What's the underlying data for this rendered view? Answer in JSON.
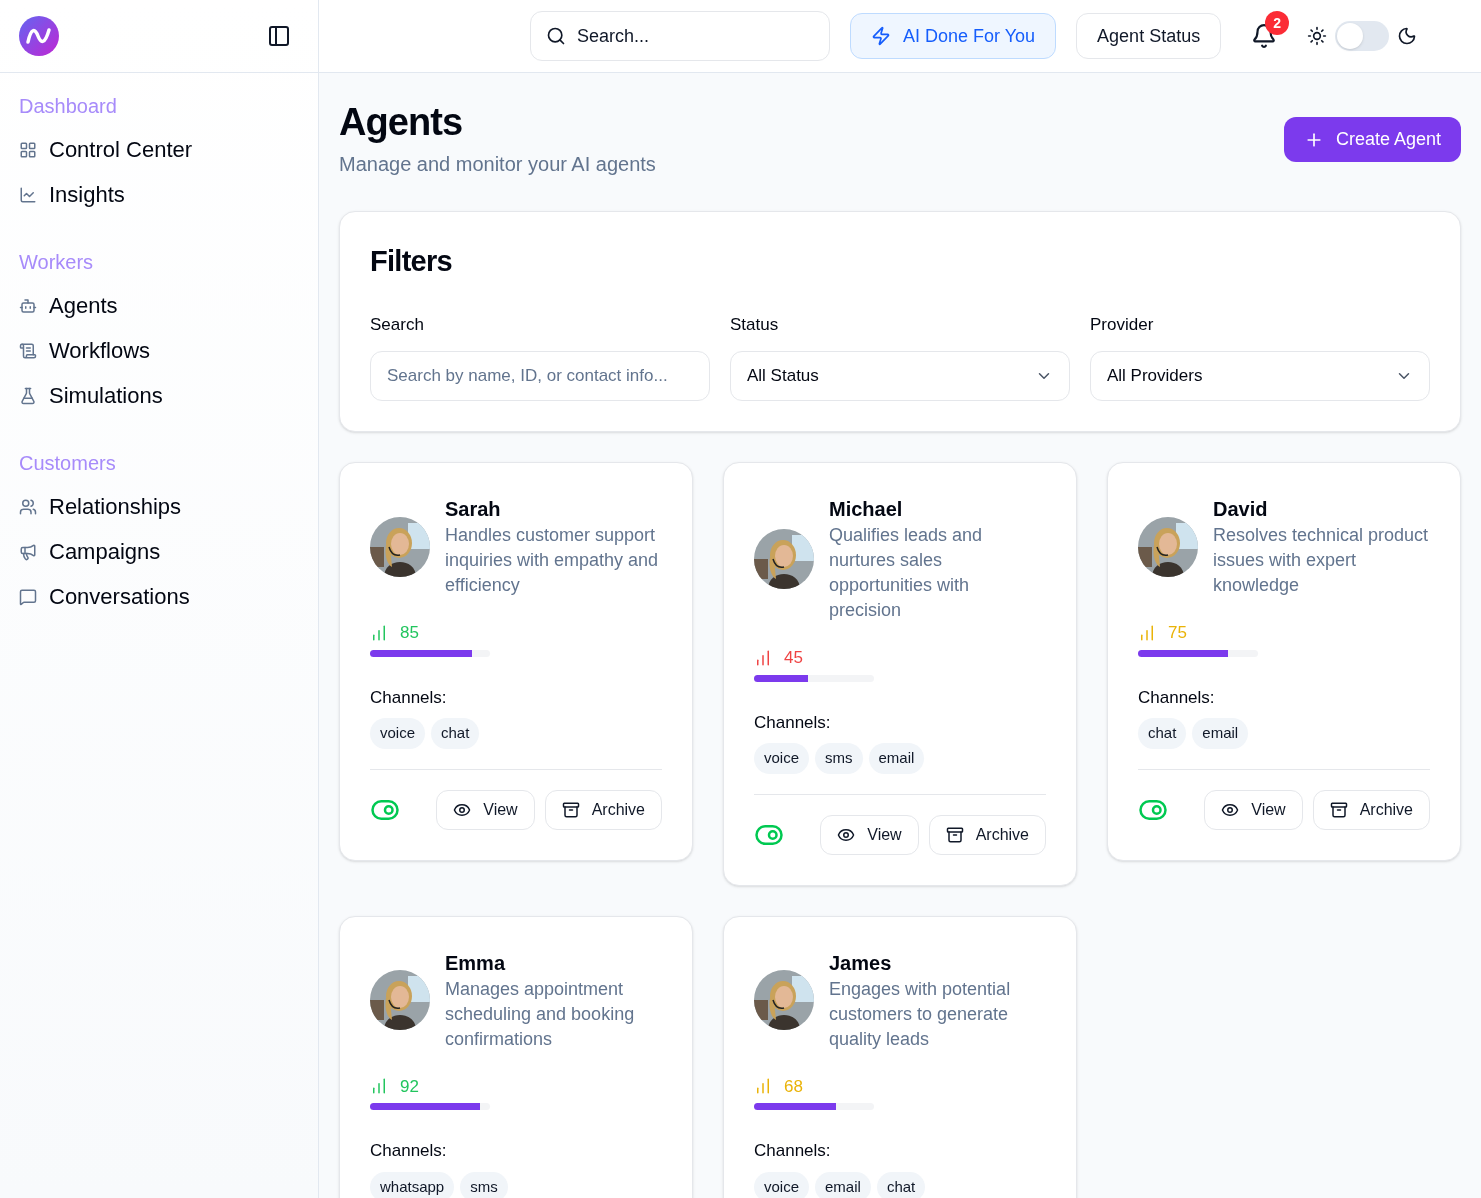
{
  "header": {
    "search": {
      "placeholder": "Search..."
    },
    "buttons": [
      {
        "label": "AI Done For You",
        "kind": "primary"
      },
      {
        "label": "Agent Status",
        "kind": "outline"
      }
    ],
    "notifications": {
      "count": "2"
    },
    "dark_mode": false
  },
  "sidebar": {
    "sections": [
      {
        "title": "Dashboard",
        "items": [
          {
            "label": "Control Center"
          },
          {
            "label": "Insights"
          }
        ]
      },
      {
        "title": "Workers",
        "items": [
          {
            "label": "Agents"
          },
          {
            "label": "Workflows"
          },
          {
            "label": "Simulations"
          }
        ]
      },
      {
        "title": "Customers",
        "items": [
          {
            "label": "Relationships"
          },
          {
            "label": "Campaigns"
          },
          {
            "label": "Conversations"
          }
        ]
      }
    ]
  },
  "page": {
    "title": "Agents",
    "subtitle": "Manage and monitor your AI agents",
    "create_button": "Create Agent"
  },
  "filters": {
    "title": "Filters",
    "fields": [
      {
        "label": "Search",
        "kind": "input",
        "placeholder": "Search by name, ID, or contact info..."
      },
      {
        "label": "Status",
        "kind": "select",
        "value": "All Status"
      },
      {
        "label": "Provider",
        "kind": "select",
        "value": "All Providers"
      }
    ]
  },
  "agents": [
    {
      "name": "Sarah",
      "description": "Handles customer support inquiries with empathy and efficiency",
      "score": "85",
      "level": 0.85,
      "color": "#22c55e",
      "channels_label": "Channels:",
      "channels": [
        "voice",
        "chat"
      ],
      "on": true,
      "actions": [
        "View",
        "Archive"
      ]
    },
    {
      "name": "Michael",
      "description": "Qualifies leads and nurtures sales opportunities with precision",
      "score": "45",
      "level": 0.45,
      "color": "#ef4444",
      "channels_label": "Channels:",
      "channels": [
        "voice",
        "sms",
        "email"
      ],
      "on": true,
      "actions": [
        "View",
        "Archive"
      ]
    },
    {
      "name": "David",
      "description": "Resolves technical product issues with expert knowledge",
      "score": "75",
      "level": 0.75,
      "color": "#eab308",
      "channels_label": "Channels:",
      "channels": [
        "chat",
        "email"
      ],
      "on": true,
      "actions": [
        "View",
        "Archive"
      ]
    },
    {
      "name": "Emma",
      "description": "Manages appointment scheduling and booking confirmations",
      "score": "92",
      "level": 0.92,
      "color": "#22c55e",
      "channels_label": "Channels:",
      "channels": [
        "whatsapp",
        "sms"
      ]
    },
    {
      "name": "James",
      "description": "Engages with potential customers to generate quality leads",
      "score": "68",
      "level": 0.68,
      "color": "#eab308",
      "channels_label": "Channels:",
      "channels": [
        "voice",
        "email",
        "chat"
      ]
    }
  ]
}
